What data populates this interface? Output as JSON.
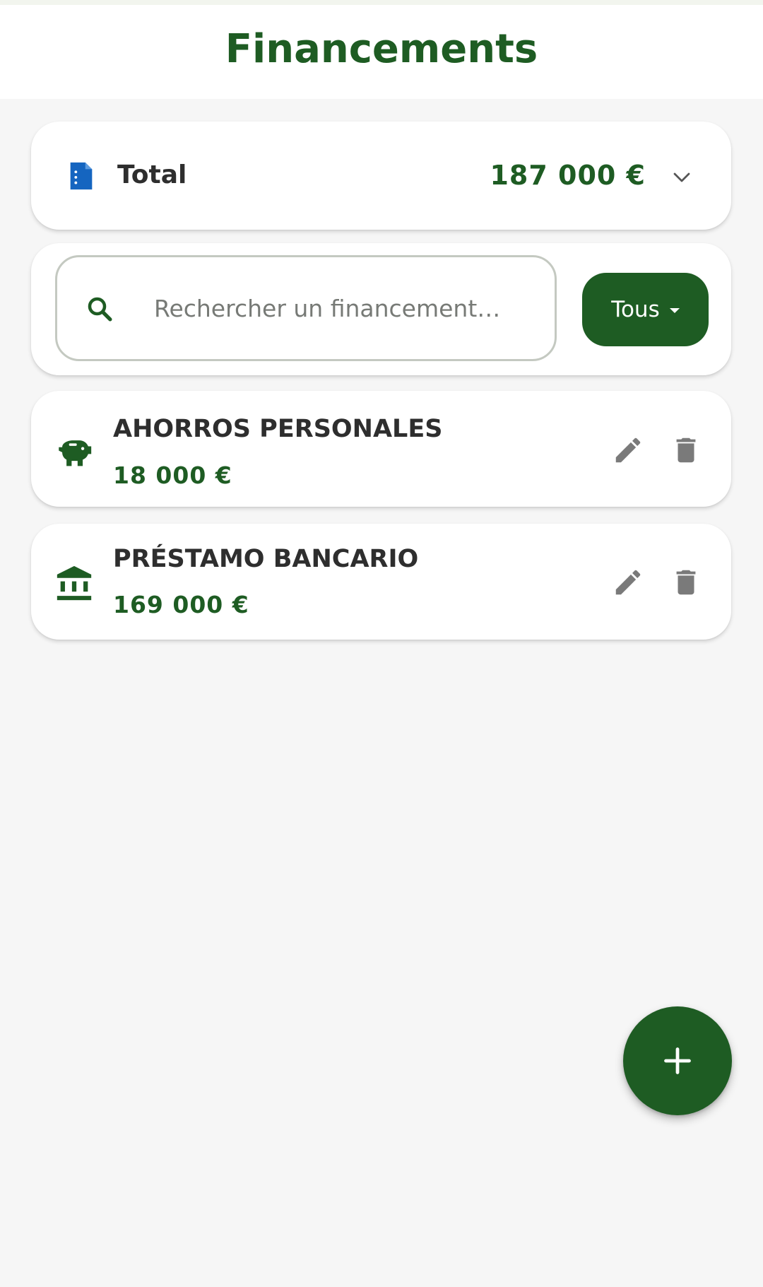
{
  "header": {
    "title": "Financements"
  },
  "summary": {
    "label": "Total",
    "amount": "187 000 €",
    "icon": "document-icon",
    "icon_color": "#1565c0"
  },
  "search": {
    "placeholder": "Rechercher un financement…",
    "value": ""
  },
  "filter": {
    "label": "Tous"
  },
  "items": [
    {
      "name": "AHORROS PERSONALES",
      "amount": "18 000 €",
      "icon": "piggy-bank-icon"
    },
    {
      "name": "PRÉSTAMO BANCARIO",
      "amount": "169 000 €",
      "icon": "bank-icon"
    }
  ],
  "colors": {
    "primary": "#1e5c23",
    "background": "#f6f6f6",
    "action_icon": "#7a7a7a"
  }
}
